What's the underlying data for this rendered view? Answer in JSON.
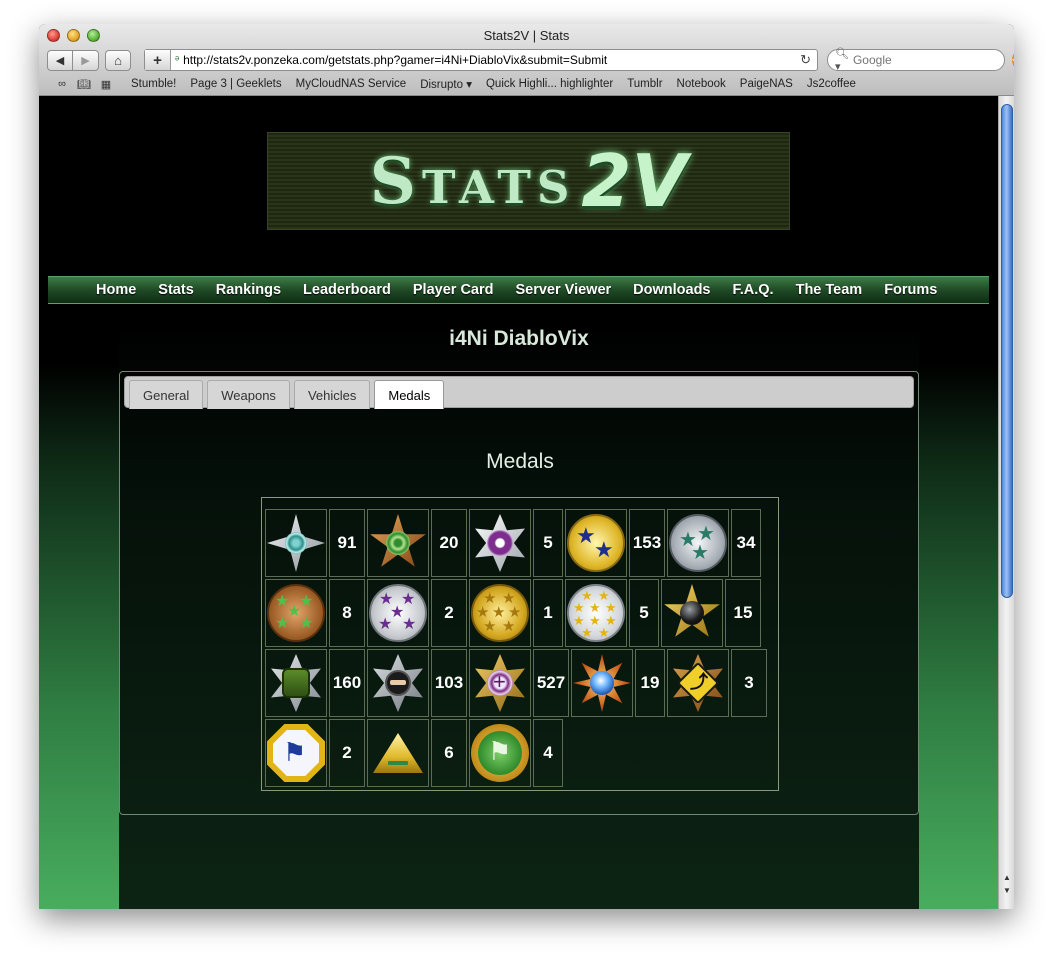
{
  "window": {
    "title": "Stats2V | Stats"
  },
  "toolbar": {
    "url": "http://stats2v.ponzeka.com/getstats.php?gamer=i4Ni+DiabloVix&submit=Submit",
    "search_placeholder": "Google"
  },
  "bookmarks": [
    "Stumble!",
    "Page 3 | Geeklets",
    "MyCloudNAS Service",
    "Disrupto ▾",
    "Quick Highli... highlighter",
    "Tumblr",
    "Notebook",
    "PaigeNAS",
    "Js2coffee"
  ],
  "site": {
    "logo_left": "Stats",
    "logo_right": "2V",
    "nav": [
      "Home",
      "Stats",
      "Rankings",
      "Leaderboard",
      "Player Card",
      "Server Viewer",
      "Downloads",
      "F.A.Q.",
      "The Team",
      "Forums"
    ]
  },
  "player": {
    "name": "i4Ni DiabloVix"
  },
  "tabs": [
    {
      "label": "General",
      "active": false
    },
    {
      "label": "Weapons",
      "active": false
    },
    {
      "label": "Vehicles",
      "active": false
    },
    {
      "label": "Medals",
      "active": true
    }
  ],
  "medals": {
    "title": "Medals",
    "rows": [
      [
        {
          "icon": "silver-star-target-medal-icon",
          "count": "91"
        },
        {
          "icon": "bronze-star-target-medal-icon",
          "count": "20"
        },
        {
          "icon": "purple-target-star-medal-icon",
          "count": "5"
        },
        {
          "icon": "gold-two-blue-stars-medal-icon",
          "count": "153"
        },
        {
          "icon": "silver-three-green-stars-medal-icon",
          "count": "34"
        }
      ],
      [
        {
          "icon": "bronze-five-green-stars-medal-icon",
          "count": "8"
        },
        {
          "icon": "silver-five-purple-stars-medal-icon",
          "count": "2"
        },
        {
          "icon": "gold-seven-stars-medal-icon",
          "count": "1"
        },
        {
          "icon": "silver-ten-gold-stars-medal-icon",
          "count": "5"
        },
        {
          "icon": "black-orb-gold-star-medal-icon",
          "count": "15"
        }
      ],
      [
        {
          "icon": "green-fist-medal-icon",
          "count": "160"
        },
        {
          "icon": "ninja-mask-medal-icon",
          "count": "103"
        },
        {
          "icon": "crosshair-gold-star-medal-icon",
          "count": "527"
        },
        {
          "icon": "blue-sunburst-medal-icon",
          "count": "19"
        },
        {
          "icon": "u-turn-sign-medal-icon",
          "count": "3"
        }
      ],
      [
        {
          "icon": "blue-flag-octagon-medal-icon",
          "count": "2"
        },
        {
          "icon": "yellow-triangle-medal-icon",
          "count": "6"
        },
        {
          "icon": "green-flag-medal-icon",
          "count": "4"
        }
      ]
    ]
  },
  "colors": {
    "nav_green": "#1f4a25",
    "page_green": "#48ad5e",
    "medal_gold": "#e0b82a",
    "medal_silver": "#c8ccd0",
    "medal_bronze": "#b06a2c"
  }
}
